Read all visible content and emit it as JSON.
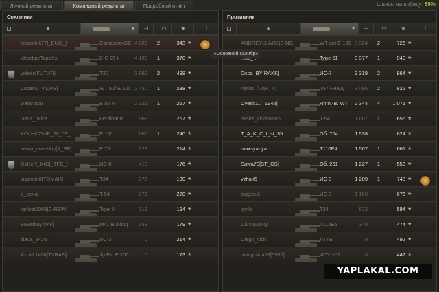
{
  "tabs": [
    {
      "label": "Личный результат",
      "active": false
    },
    {
      "label": "Командный результат",
      "active": true
    },
    {
      "label": "Подробный отчёт",
      "active": false
    }
  ],
  "win_chance": {
    "label": "Шансы на победу:",
    "value": "59%"
  },
  "tooltip": "«Основной калибр»",
  "watermark": "YAPLAKAL.COM",
  "ally": {
    "title": "Союзники",
    "columns": [
      "squad-icon",
      "player-icon",
      "tank-icon",
      "damage-sort-icon",
      "frags-icon",
      "xp-icon",
      "medal-icon"
    ],
    "rows": [
      {
        "player": "aidarchik77[_BUG_]",
        "tank": "ConquerorGC",
        "damage": "4 288",
        "frags": "2",
        "xp": "343",
        "alive": false,
        "me": true,
        "medal": true,
        "badge": false
      },
      {
        "player": "xXcekpeTapbXx",
        "tank": "B-C 25 t",
        "damage": "4 188",
        "frags": "1",
        "xp": "370",
        "alive": false,
        "me": false,
        "medal": false,
        "badge": false
      },
      {
        "player": "yoless[FUTUR]",
        "tank": "T30",
        "damage": "3 092",
        "frags": "2",
        "xp": "498",
        "alive": false,
        "me": false,
        "medal": false,
        "badge": true
      },
      {
        "player": "LabanO_v[DPE]",
        "tank": "WT auf E 100",
        "damage": "2 430",
        "frags": "1",
        "xp": "288",
        "alive": false,
        "me": false,
        "medal": false,
        "badge": false
      },
      {
        "player": "Detanatar",
        "tank": "E 50 M",
        "damage": "2 321",
        "frags": "1",
        "xp": "267",
        "alive": false,
        "me": false,
        "medal": false,
        "badge": false
      },
      {
        "player": "Dima_talica",
        "tank": "Ferdinand",
        "damage": "968",
        "frags": "",
        "xp": "267",
        "alive": false,
        "me": false,
        "medal": false,
        "badge": false
      },
      {
        "player": "KOLHOZNIK_20_09_",
        "tank": "E 100",
        "damage": "666",
        "frags": "1",
        "xp": "240",
        "alive": false,
        "me": false,
        "medal": false,
        "badge": false
      },
      {
        "player": "sema_novitskiy[A_RF]",
        "tank": "E 75",
        "damage": "528",
        "frags": "",
        "xp": "214",
        "alive": false,
        "me": false,
        "medal": false,
        "badge": false
      },
      {
        "player": "DoKeR_KrG[_TFC_]",
        "tank": "ИС-8",
        "damage": "418",
        "frags": "",
        "xp": "176",
        "alive": false,
        "me": false,
        "medal": false,
        "badge": true
      },
      {
        "player": "sugrobit0[TOMAH]",
        "tank": "T34",
        "damage": "377",
        "frags": "",
        "xp": "180",
        "alive": false,
        "me": false,
        "medal": false,
        "badge": false
      },
      {
        "player": "e_cerko",
        "tank": "T-54",
        "damage": "371",
        "frags": "",
        "xp": "220",
        "alive": false,
        "me": false,
        "medal": false,
        "badge": false
      },
      {
        "player": "tankist0009[C-REW]",
        "tank": "Tiger II",
        "damage": "319",
        "frags": "",
        "xp": "194",
        "alive": false,
        "me": false,
        "medal": false,
        "badge": false
      },
      {
        "player": "Severboy[IVY]",
        "tank": "M41 Bulldog",
        "damage": "248",
        "frags": "",
        "xp": "179",
        "alive": false,
        "me": false,
        "medal": false,
        "badge": false
      },
      {
        "player": "slava_8426",
        "tank": "ИС-3",
        "damage": "0",
        "frags": "",
        "xp": "214",
        "alive": false,
        "me": false,
        "medal": false,
        "badge": false
      },
      {
        "player": "AzraiL1408[TYRAS]",
        "tank": "Jg.Pz. E 100",
        "damage": "0",
        "frags": "",
        "xp": "173",
        "alive": false,
        "me": false,
        "medal": false,
        "badge": false
      }
    ]
  },
  "enemy": {
    "title": "Противник",
    "columns": [
      "squad-icon",
      "player-icon",
      "tank-icon",
      "damage-sort-icon",
      "frags-icon",
      "xp-icon",
      "medal-icon"
    ],
    "rows": [
      {
        "player": "ANDREYLUM67[S-NG]",
        "tank": "WT auf E 100",
        "damage": "3 384",
        "frags": "2",
        "xp": "726",
        "alive": false,
        "medal": false
      },
      {
        "player": "...ka_...",
        "tank": "Type 61",
        "damage": "3 377",
        "frags": "1",
        "xp": "940",
        "alive": true,
        "medal": false
      },
      {
        "player": "Occa_BY[RAKK]",
        "tank": "ИС-7",
        "damage": "3 318",
        "frags": "2",
        "xp": "864",
        "alive": true,
        "medal": false
      },
      {
        "player": "Aptist_[UKR_A]",
        "tank": "T57 Heavy",
        "damage": "3 096",
        "frags": "2",
        "xp": "822",
        "alive": false,
        "medal": false
      },
      {
        "player": "Cvetik11[_1945]",
        "tank": "Rhm.-B. WT",
        "damage": "2 344",
        "frags": "4",
        "xp": "1 071",
        "alive": true,
        "medal": false
      },
      {
        "player": "misha_likvidator5",
        "tank": "T-54",
        "damage": "1 607",
        "frags": "1",
        "xp": "656",
        "alive": false,
        "medal": false
      },
      {
        "player": "T_A_K_C_I_st_35",
        "tank": "Об. 704",
        "damage": "1 538",
        "frags": "",
        "xp": "624",
        "alive": true,
        "medal": false
      },
      {
        "player": "maxsyanya",
        "tank": "T110E4",
        "damage": "1 507",
        "frags": "1",
        "xp": "661",
        "alive": true,
        "medal": false
      },
      {
        "player": "Sawa70[ST_GS]",
        "tank": "Об. 261",
        "damage": "1 227",
        "frags": "1",
        "xp": "553",
        "alive": true,
        "medal": false
      },
      {
        "player": "vzhuk5",
        "tank": "ИС-3",
        "damage": "1 209",
        "frags": "1",
        "xp": "743",
        "alive": true,
        "medal": true
      },
      {
        "player": "biggipuk",
        "tank": "ИС-3",
        "damage": "1 189",
        "frags": "",
        "xp": "676",
        "alive": false,
        "medal": false
      },
      {
        "player": "igvils",
        "tank": "T34",
        "damage": "872",
        "frags": "",
        "xp": "594",
        "alive": false,
        "medal": false
      },
      {
        "player": "DarckLucky",
        "tank": "T110E5",
        "damage": "348",
        "frags": "",
        "xp": "474",
        "alive": false,
        "medal": false
      },
      {
        "player": "Dlego_vich",
        "tank": "ЛТТБ",
        "damage": "0",
        "frags": "",
        "xp": "492",
        "alive": false,
        "medal": false
      },
      {
        "player": "mongolina53[5530]",
        "tank": "ИСУ-152",
        "damage": "0",
        "frags": "",
        "xp": "442",
        "alive": false,
        "medal": false
      }
    ]
  }
}
